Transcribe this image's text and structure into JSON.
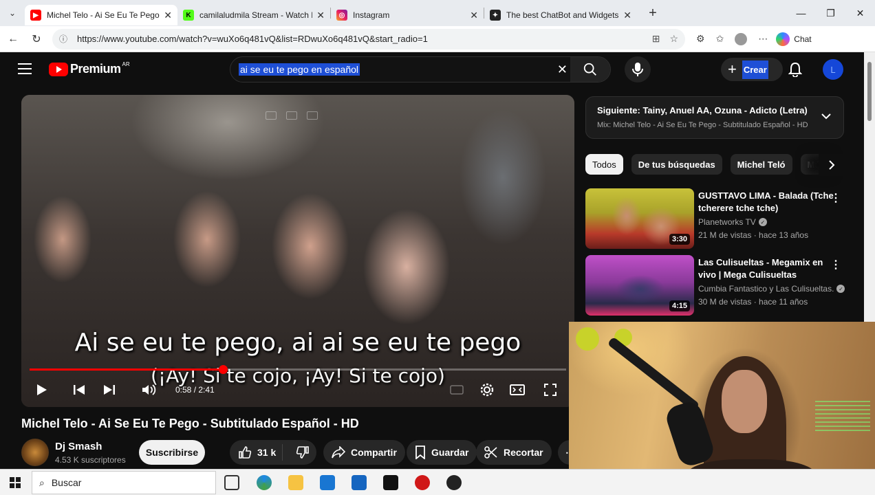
{
  "browser": {
    "tabs": [
      {
        "title": "Michel Telo - Ai Se Eu Te Pego - Su",
        "favicon": "youtube-icon",
        "active": true
      },
      {
        "title": "camilaludmila Stream - Watch Live",
        "favicon": "kick-icon",
        "active": false
      },
      {
        "title": "Instagram",
        "favicon": "instagram-icon",
        "active": false
      },
      {
        "title": "The best ChatBot and Widgets for",
        "favicon": "chatbot-icon",
        "active": false
      }
    ],
    "url": "https://www.youtube.com/watch?v=wuXo6q481vQ&list=RDwuXo6q481vQ&start_radio=1",
    "chat_label": "Chat"
  },
  "youtube": {
    "logo_text": "Premium",
    "region": "AR",
    "search_query": "ai se eu te pego en español",
    "create_label": "Crear",
    "avatar_letter": "L"
  },
  "player": {
    "subtitle_line1": "Ai se eu te pego, ai ai se eu te pego",
    "subtitle_line2": "(¡Ay! Si te cojo, ¡Ay! Si te cojo)",
    "time_current": "0:58",
    "time_total": "2:41",
    "time_label": "0:58 / 2:41",
    "progress_fraction": 0.36
  },
  "video": {
    "title": "Michel Telo - Ai Se Eu Te Pego - Subtitulado Español - HD",
    "channel": "Dj Smash",
    "subscribers": "4.53 K suscriptores",
    "subscribe_label": "Suscribirse",
    "likes": "31 k",
    "share_label": "Compartir",
    "save_label": "Guardar",
    "clip_label": "Recortar"
  },
  "sidebar": {
    "up_next_title": "Siguiente: Tainy, Anuel AA, Ozuna - Adicto (Letra)",
    "up_next_mix": "Mix: Michel Telo - Ai Se Eu Te Pego - Subtitulado Español - HD",
    "chips": [
      "Todos",
      "De tus búsquedas",
      "Michel Teló",
      "Mú"
    ],
    "recommendations": [
      {
        "title": "GUSTTAVO LIMA - Balada (Tche tcherere tche tche)",
        "channel": "Planetworks TV",
        "meta": "21 M de vistas · hace 13 años",
        "duration": "3:30"
      },
      {
        "title": "Las Culisueltas - Megamix en vivo | Mega Culisueltas",
        "channel": "Cumbia Fantastico  y Las Culisueltas.",
        "meta": "30 M de vistas · hace 11 años",
        "duration": "4:15"
      }
    ]
  },
  "taskbar": {
    "search_placeholder": "Buscar"
  },
  "colors": {
    "youtube_red": "#ff0000",
    "selection_blue": "#1e4fd6",
    "background": "#0f0f0f"
  }
}
